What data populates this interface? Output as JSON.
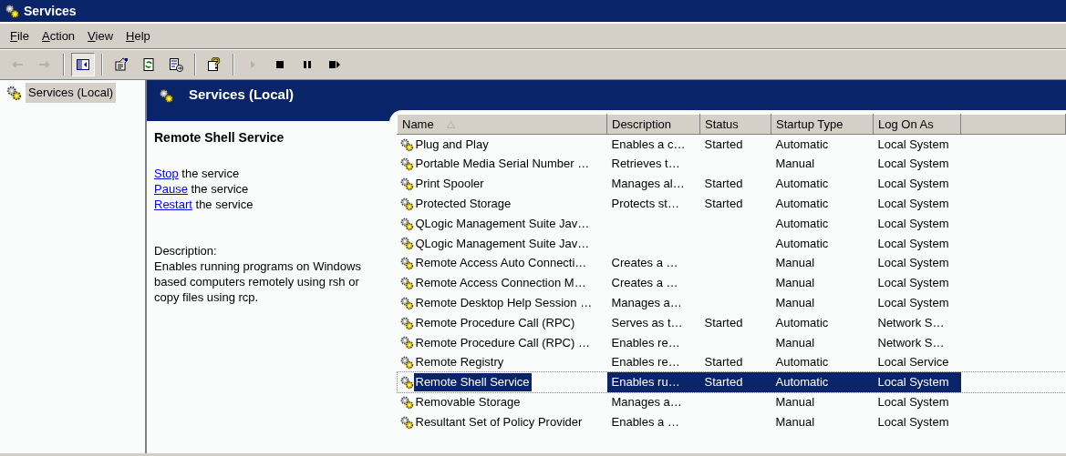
{
  "window": {
    "title": "Services"
  },
  "menu": [
    "File",
    "Action",
    "View",
    "Help"
  ],
  "toolbar": [
    {
      "kind": "back",
      "disabled": true,
      "pressed": false
    },
    {
      "kind": "forward",
      "disabled": true,
      "pressed": false
    },
    {
      "kind": "separator"
    },
    {
      "kind": "console-tree",
      "disabled": false,
      "pressed": true
    },
    {
      "kind": "separator"
    },
    {
      "kind": "properties",
      "disabled": false,
      "pressed": false
    },
    {
      "kind": "refresh",
      "disabled": false,
      "pressed": false
    },
    {
      "kind": "export",
      "disabled": false,
      "pressed": false
    },
    {
      "kind": "separator"
    },
    {
      "kind": "help",
      "disabled": false,
      "pressed": false
    },
    {
      "kind": "separator"
    },
    {
      "kind": "start",
      "disabled": true,
      "pressed": false
    },
    {
      "kind": "stop",
      "disabled": false,
      "pressed": false
    },
    {
      "kind": "pause",
      "disabled": false,
      "pressed": false
    },
    {
      "kind": "resume",
      "disabled": false,
      "pressed": false
    }
  ],
  "tree": [
    {
      "label": "Services (Local)",
      "selected": true
    }
  ],
  "pane": {
    "title": "Services (Local)"
  },
  "details": {
    "service_name": "Remote Shell Service",
    "actions": [
      {
        "link": "Stop",
        "text": " the service"
      },
      {
        "link": "Pause",
        "text": " the service"
      },
      {
        "link": "Restart",
        "text": " the service"
      }
    ],
    "description_label": "Description:",
    "description": "Enables running programs on Windows based computers remotely using rsh or copy files using rcp."
  },
  "table": {
    "columns": [
      {
        "label": "Name",
        "sorted": true
      },
      {
        "label": "Description",
        "sorted": false
      },
      {
        "label": "Status",
        "sorted": false
      },
      {
        "label": "Startup Type",
        "sorted": false
      },
      {
        "label": "Log On As",
        "sorted": false
      }
    ],
    "rows": [
      {
        "name": "Plug and Play",
        "description": "Enables a c…",
        "status": "Started",
        "startup_type": "Automatic",
        "log_on_as": "Local System",
        "selected": false
      },
      {
        "name": "Portable Media Serial Number …",
        "description": "Retrieves t…",
        "startup_type": "Manual",
        "log_on_as": "Local System",
        "selected": false
      },
      {
        "name": "Print Spooler",
        "description": "Manages al…",
        "status": "Started",
        "startup_type": "Automatic",
        "log_on_as": "Local System",
        "selected": false
      },
      {
        "name": "Protected Storage",
        "description": "Protects st…",
        "status": "Started",
        "startup_type": "Automatic",
        "log_on_as": "Local System",
        "selected": false
      },
      {
        "name": "QLogic Management Suite Jav…",
        "startup_type": "Automatic",
        "log_on_as": "Local System",
        "selected": false
      },
      {
        "name": "QLogic Management Suite Jav…",
        "startup_type": "Automatic",
        "log_on_as": "Local System",
        "selected": false
      },
      {
        "name": "Remote Access Auto Connecti…",
        "description": "Creates a …",
        "startup_type": "Manual",
        "log_on_as": "Local System",
        "selected": false
      },
      {
        "name": "Remote Access Connection M…",
        "description": "Creates a …",
        "startup_type": "Manual",
        "log_on_as": "Local System",
        "selected": false
      },
      {
        "name": "Remote Desktop Help Session …",
        "description": "Manages a…",
        "startup_type": "Manual",
        "log_on_as": "Local System",
        "selected": false
      },
      {
        "name": "Remote Procedure Call (RPC)",
        "description": "Serves as t…",
        "status": "Started",
        "startup_type": "Automatic",
        "log_on_as": "Network S…",
        "selected": false
      },
      {
        "name": "Remote Procedure Call (RPC) …",
        "description": "Enables re…",
        "startup_type": "Manual",
        "log_on_as": "Network S…",
        "selected": false
      },
      {
        "name": "Remote Registry",
        "description": "Enables re…",
        "status": "Started",
        "startup_type": "Automatic",
        "log_on_as": "Local Service",
        "selected": false
      },
      {
        "name": "Remote Shell Service",
        "description": "Enables ru…",
        "status": "Started",
        "startup_type": "Automatic",
        "log_on_as": "Local System",
        "selected": true
      },
      {
        "name": "Removable Storage",
        "description": "Manages a…",
        "startup_type": "Manual",
        "log_on_as": "Local System",
        "selected": false
      },
      {
        "name": "Resultant Set of Policy Provider",
        "description": "Enables a …",
        "startup_type": "Manual",
        "log_on_as": "Local System",
        "selected": false
      }
    ]
  }
}
